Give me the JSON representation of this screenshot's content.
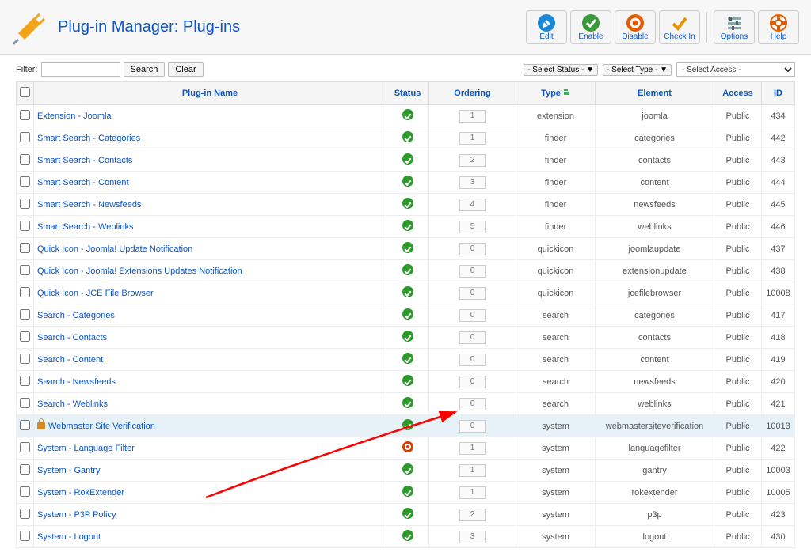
{
  "header": {
    "title": "Plug-in Manager: Plug-ins"
  },
  "toolbar": {
    "edit": "Edit",
    "enable": "Enable",
    "disable": "Disable",
    "checkin": "Check In",
    "options": "Options",
    "help": "Help"
  },
  "filters": {
    "label": "Filter:",
    "value": "",
    "search": "Search",
    "clear": "Clear",
    "status_select": "- Select Status - ▼",
    "type_select": "- Select Type - ▼",
    "access_select": "- Select Access -"
  },
  "columns": {
    "name": "Plug-in Name",
    "status": "Status",
    "ordering": "Ordering",
    "type": "Type",
    "element": "Element",
    "access": "Access",
    "id": "ID"
  },
  "rows": [
    {
      "name": "Extension - Joomla",
      "status": "enabled",
      "ordering": "1",
      "type": "extension",
      "element": "joomla",
      "access": "Public",
      "id": "434",
      "locked": false,
      "highlight": false
    },
    {
      "name": "Smart Search - Categories",
      "status": "enabled",
      "ordering": "1",
      "type": "finder",
      "element": "categories",
      "access": "Public",
      "id": "442",
      "locked": false,
      "highlight": false
    },
    {
      "name": "Smart Search - Contacts",
      "status": "enabled",
      "ordering": "2",
      "type": "finder",
      "element": "contacts",
      "access": "Public",
      "id": "443",
      "locked": false,
      "highlight": false
    },
    {
      "name": "Smart Search - Content",
      "status": "enabled",
      "ordering": "3",
      "type": "finder",
      "element": "content",
      "access": "Public",
      "id": "444",
      "locked": false,
      "highlight": false
    },
    {
      "name": "Smart Search - Newsfeeds",
      "status": "enabled",
      "ordering": "4",
      "type": "finder",
      "element": "newsfeeds",
      "access": "Public",
      "id": "445",
      "locked": false,
      "highlight": false
    },
    {
      "name": "Smart Search - Weblinks",
      "status": "enabled",
      "ordering": "5",
      "type": "finder",
      "element": "weblinks",
      "access": "Public",
      "id": "446",
      "locked": false,
      "highlight": false
    },
    {
      "name": "Quick Icon - Joomla! Update Notification",
      "status": "enabled",
      "ordering": "0",
      "type": "quickicon",
      "element": "joomlaupdate",
      "access": "Public",
      "id": "437",
      "locked": false,
      "highlight": false
    },
    {
      "name": "Quick Icon - Joomla! Extensions Updates Notification",
      "status": "enabled",
      "ordering": "0",
      "type": "quickicon",
      "element": "extensionupdate",
      "access": "Public",
      "id": "438",
      "locked": false,
      "highlight": false
    },
    {
      "name": "Quick Icon - JCE File Browser",
      "status": "enabled",
      "ordering": "0",
      "type": "quickicon",
      "element": "jcefilebrowser",
      "access": "Public",
      "id": "10008",
      "locked": false,
      "highlight": false
    },
    {
      "name": "Search - Categories",
      "status": "enabled",
      "ordering": "0",
      "type": "search",
      "element": "categories",
      "access": "Public",
      "id": "417",
      "locked": false,
      "highlight": false
    },
    {
      "name": "Search - Contacts",
      "status": "enabled",
      "ordering": "0",
      "type": "search",
      "element": "contacts",
      "access": "Public",
      "id": "418",
      "locked": false,
      "highlight": false
    },
    {
      "name": "Search - Content",
      "status": "enabled",
      "ordering": "0",
      "type": "search",
      "element": "content",
      "access": "Public",
      "id": "419",
      "locked": false,
      "highlight": false
    },
    {
      "name": "Search - Newsfeeds",
      "status": "enabled",
      "ordering": "0",
      "type": "search",
      "element": "newsfeeds",
      "access": "Public",
      "id": "420",
      "locked": false,
      "highlight": false
    },
    {
      "name": "Search - Weblinks",
      "status": "enabled",
      "ordering": "0",
      "type": "search",
      "element": "weblinks",
      "access": "Public",
      "id": "421",
      "locked": false,
      "highlight": false
    },
    {
      "name": "Webmaster Site Verification",
      "status": "enabled",
      "ordering": "0",
      "type": "system",
      "element": "webmastersiteverification",
      "access": "Public",
      "id": "10013",
      "locked": true,
      "highlight": true
    },
    {
      "name": "System - Language Filter",
      "status": "disabled",
      "ordering": "1",
      "type": "system",
      "element": "languagefilter",
      "access": "Public",
      "id": "422",
      "locked": false,
      "highlight": false
    },
    {
      "name": "System - Gantry",
      "status": "enabled",
      "ordering": "1",
      "type": "system",
      "element": "gantry",
      "access": "Public",
      "id": "10003",
      "locked": false,
      "highlight": false
    },
    {
      "name": "System - RokExtender",
      "status": "enabled",
      "ordering": "1",
      "type": "system",
      "element": "rokextender",
      "access": "Public",
      "id": "10005",
      "locked": false,
      "highlight": false
    },
    {
      "name": "System - P3P Policy",
      "status": "enabled",
      "ordering": "2",
      "type": "system",
      "element": "p3p",
      "access": "Public",
      "id": "423",
      "locked": false,
      "highlight": false
    },
    {
      "name": "System - Logout",
      "status": "enabled",
      "ordering": "3",
      "type": "system",
      "element": "logout",
      "access": "Public",
      "id": "430",
      "locked": false,
      "highlight": false
    }
  ]
}
